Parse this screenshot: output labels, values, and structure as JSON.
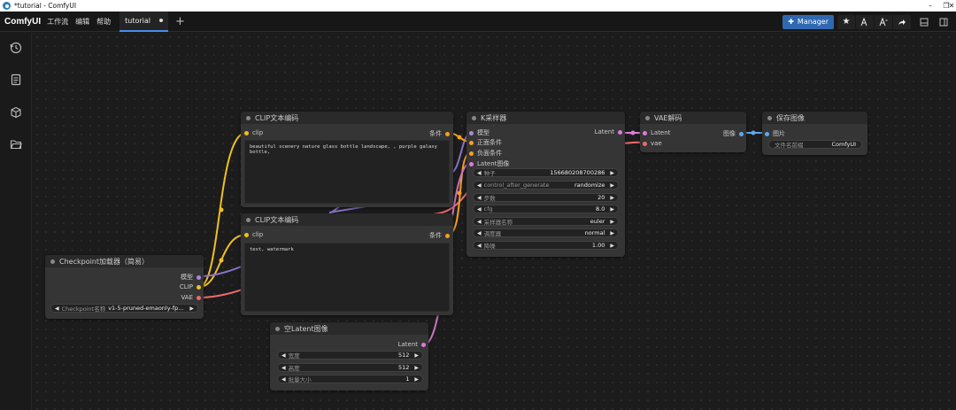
{
  "window": {
    "title": "*tutorial - ComfyUI",
    "controls": {
      "minimize": "–",
      "restore": "❐",
      "close": "✕"
    }
  },
  "menubar": {
    "logo": "ComfyUI",
    "items": [
      "工作流",
      "编辑",
      "帮助"
    ],
    "tab": {
      "label": "tutorial"
    },
    "add_tab": "+",
    "manager_label": "Manager"
  },
  "colors": {
    "clip": "#f0c020",
    "model": "#a78bd6",
    "vae": "#ee6a6a",
    "conditioning": "#f4a020",
    "latent": "#e07ad8",
    "image": "#5aa9ee",
    "accent": "#2f68b1"
  },
  "sidebar": {
    "icons": [
      "history-icon",
      "queue-icon",
      "cube-icon",
      "folder-icon"
    ]
  },
  "nodes": {
    "clip_pos": {
      "title": "CLIP文本编码",
      "input": "clip",
      "output": "条件",
      "text": "beautiful scenery nature glass bottle landscape, , purple galaxy bottle,"
    },
    "clip_neg": {
      "title": "CLIP文本编码",
      "input": "clip",
      "output": "条件",
      "text": "text, watermark"
    },
    "checkpoint": {
      "title": "Checkpoint加载器（简易）",
      "outputs": [
        "模型",
        "CLIP",
        "VAE"
      ],
      "widget": {
        "label": "Checkpoint名称",
        "value": "v1-5-pruned-emaonly-fp..."
      }
    },
    "ksampler": {
      "title": "K采样器",
      "inputs": [
        "模型",
        "正面条件",
        "负面条件",
        "Latent图像"
      ],
      "output": "Latent",
      "widgets": [
        {
          "label": "种子",
          "value": "156680208700286"
        },
        {
          "label": "control_after_generate",
          "value": "randomize"
        },
        {
          "label": "步数",
          "value": "20"
        },
        {
          "label": "cfg",
          "value": "8.0"
        },
        {
          "label": "采样器名称",
          "value": "euler"
        },
        {
          "label": "调度器",
          "value": "normal"
        },
        {
          "label": "降噪",
          "value": "1.00"
        }
      ]
    },
    "vae_decode": {
      "title": "VAE解码",
      "inputs": [
        "Latent",
        "vae"
      ],
      "output": "图像"
    },
    "save_image": {
      "title": "保存图像",
      "input": "图片",
      "widget": {
        "label": "文件名前缀",
        "value": "ComfyUI"
      }
    },
    "empty_latent": {
      "title": "空Latent图像",
      "output": "Latent",
      "widgets": [
        {
          "label": "宽度",
          "value": "512"
        },
        {
          "label": "高度",
          "value": "512"
        },
        {
          "label": "批量大小",
          "value": "1"
        }
      ]
    }
  }
}
